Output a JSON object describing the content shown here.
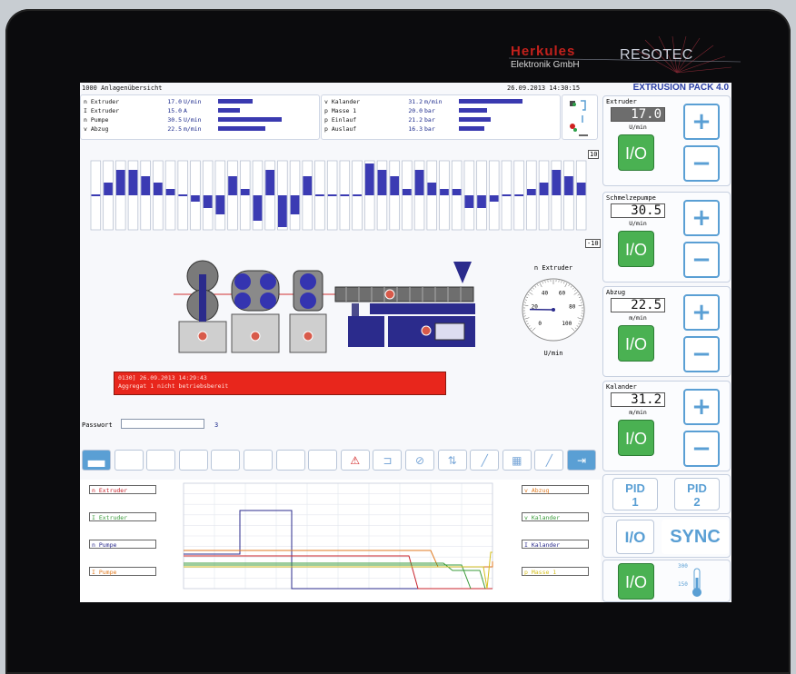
{
  "brand": {
    "company": "Herkules",
    "sub": "Elektronik GmbH",
    "partner": "RESOTEC"
  },
  "screen": {
    "title": "1000 Anlagenübersicht",
    "datetime": "26.09.2013 14:30:15",
    "product": "EXTRUSION PACK 4.0"
  },
  "values_left": [
    {
      "name": "n Extruder",
      "value": "17.0",
      "unit": "U/min",
      "level": 0.27
    },
    {
      "name": "I Extruder",
      "value": "15.0",
      "unit": "A",
      "level": 0.17
    },
    {
      "name": "n Pumpe",
      "value": "30.5",
      "unit": "U/min",
      "level": 0.5
    },
    {
      "name": "v Abzug",
      "value": "22.5",
      "unit": "m/min",
      "level": 0.37
    }
  ],
  "values_right": [
    {
      "name": "v Kalander",
      "value": "31.2",
      "unit": "m/min",
      "level": 0.5
    },
    {
      "name": "p Masse 1",
      "value": "20.0",
      "unit": "bar",
      "level": 0.22
    },
    {
      "name": "p Einlauf",
      "value": "21.2",
      "unit": "bar",
      "level": 0.25
    },
    {
      "name": "p Auslauf",
      "value": "16.3",
      "unit": "bar",
      "level": 0.2
    }
  ],
  "deviation": {
    "max": "10",
    "min": "-10",
    "values": [
      0,
      2,
      4,
      4,
      3,
      2,
      1,
      0,
      -1,
      -2,
      -3,
      3,
      1,
      -4,
      4,
      -5,
      -3,
      3,
      0,
      0,
      0,
      0,
      5,
      4,
      3,
      1,
      4,
      2,
      1,
      1,
      -2,
      -2,
      -1,
      0,
      0,
      1,
      2,
      4,
      3,
      2
    ]
  },
  "gauge": {
    "label": "n Extruder",
    "unit": "U/min",
    "ticks": [
      "0",
      "20",
      "40",
      "60",
      "80",
      "100"
    ],
    "value": 17.0
  },
  "alarm": {
    "line1": "0130] 26.09.2013 14:29:43",
    "line2": "Aggregat 1 nicht betriebsbereit"
  },
  "password": {
    "label": "Passwort",
    "value": "",
    "count": "3"
  },
  "toolbar": [
    "overview",
    "",
    "",
    "",
    "",
    "",
    "",
    "",
    "warning",
    "door",
    "stop",
    "updown",
    "pen",
    "grid",
    "brush",
    "exit"
  ],
  "trend": {
    "legend_left": [
      {
        "name": "n Extruder",
        "color": "#c8232b"
      },
      {
        "name": "I Extruder",
        "color": "#3a9b3a"
      },
      {
        "name": "n Pumpe",
        "color": "#2b2b8c"
      },
      {
        "name": "I Pumpe",
        "color": "#e07a20"
      }
    ],
    "legend_right": [
      {
        "name": "v Abzug",
        "color": "#e07a20"
      },
      {
        "name": "v Kalander",
        "color": "#3a9b3a"
      },
      {
        "name": "I Kalander",
        "color": "#2b2b8c"
      },
      {
        "name": "p Masse 1",
        "color": "#d6c020"
      }
    ]
  },
  "side": [
    {
      "title": "Extruder",
      "value": "17.0",
      "unit": "U/min",
      "dark": true
    },
    {
      "title": "Schmelzepumpe",
      "value": "30.5",
      "unit": "U/min",
      "dark": false
    },
    {
      "title": "Abzug",
      "value": "22.5",
      "unit": "m/min",
      "dark": false
    },
    {
      "title": "Kalander",
      "value": "31.2",
      "unit": "m/min",
      "dark": false
    }
  ],
  "buttons": {
    "io": "I/O",
    "plus": "+",
    "minus": "−",
    "pid1a": "PID",
    "pid1b": "1",
    "pid2a": "PID",
    "pid2b": "2",
    "sync": "SYNC",
    "temp_hi": "300",
    "temp_lo": "150"
  }
}
